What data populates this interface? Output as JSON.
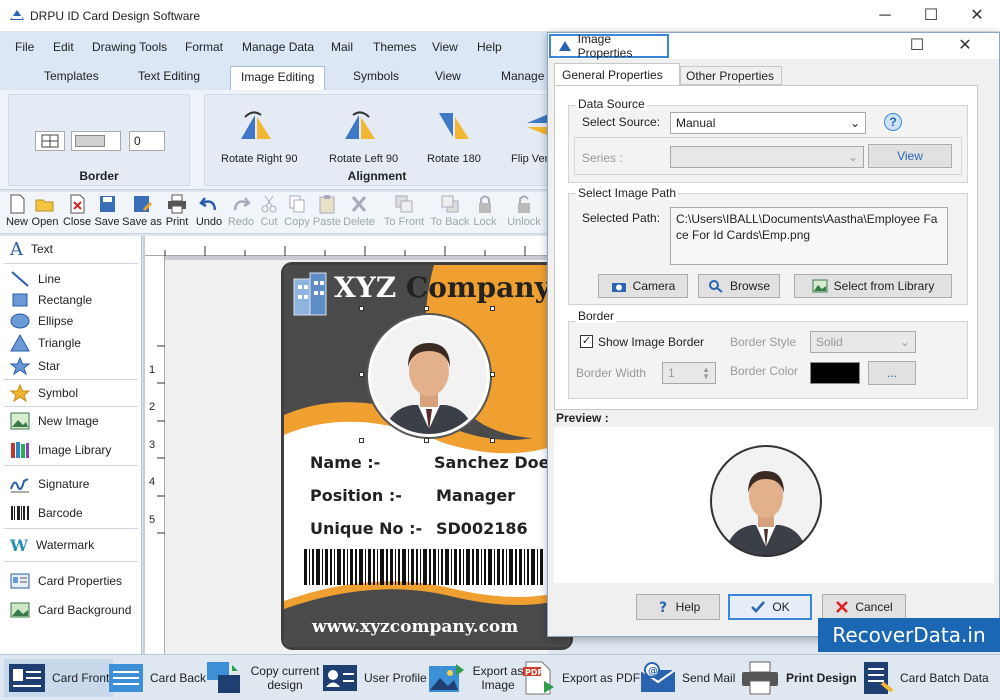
{
  "app": {
    "title": "DRPU ID Card Design Software"
  },
  "menu": [
    "File",
    "Edit",
    "Drawing Tools",
    "Format",
    "Manage Data",
    "Mail",
    "Themes",
    "View",
    "Help"
  ],
  "ribbon_tabs": [
    "Templates",
    "Text Editing",
    "Image Editing",
    "Symbols",
    "View",
    "Manage"
  ],
  "ribbon": {
    "border_label": "Border",
    "alignment_label": "Alignment",
    "border_value": "0",
    "rotate_right": "Rotate Right 90",
    "rotate_left": "Rotate Left 90",
    "rotate_180": "Rotate 180",
    "flip_vertical": "Flip Ver"
  },
  "toolbar": [
    "New",
    "Open",
    "Close",
    "Save",
    "Save as",
    "Print",
    "Undo",
    "Redo",
    "Cut",
    "Copy",
    "Paste",
    "Delete",
    "To Front",
    "To Back",
    "Lock",
    "Unlock"
  ],
  "tools": [
    "Text",
    "Line",
    "Rectangle",
    "Ellipse",
    "Triangle",
    "Star",
    "Symbol",
    "New Image",
    "Image Library",
    "Signature",
    "Barcode",
    "Watermark",
    "Card Properties",
    "Card Background"
  ],
  "ruler": [
    "1",
    "2",
    "3",
    "4",
    "5"
  ],
  "card": {
    "company": "XYZ Company",
    "name_label": "Name :-",
    "name_value": "Sanchez Doe",
    "position_label": "Position :-",
    "position_value": "Manager",
    "unique_label": "Unique No :-",
    "unique_value": "SD002186",
    "website": "www.xyzcompany.com"
  },
  "dialog": {
    "title": "Image Properties",
    "tab_general": "General Properties",
    "tab_other": "Other Properties",
    "data_source_title": "Data Source",
    "select_source_label": "Select Source:",
    "select_source_value": "Manual",
    "series_label": "Series :",
    "view_button": "View",
    "image_path_title": "Select Image Path",
    "selected_path_label": "Selected Path:",
    "selected_path_value": "C:\\Users\\IBALL\\Documents\\Aastha\\Employee Face For Id Cards\\Emp.png",
    "camera_button": "Camera",
    "browse_button": "Browse",
    "library_button": "Select from Library",
    "border_title": "Border",
    "show_border_label": "Show Image Border",
    "border_style_label": "Border Style",
    "border_style_value": "Solid",
    "border_width_label": "Border Width",
    "border_width_value": "1",
    "border_color_label": "Border Color",
    "border_color_value": "#000000",
    "color_button": "...",
    "preview_label": "Preview :",
    "help_button": "Help",
    "ok_button": "OK",
    "cancel_button": "Cancel"
  },
  "taskbar": [
    "Card Front",
    "Card Back",
    "Copy current design",
    "User Profile",
    "Export as Image",
    "Export as PDF",
    "Send Mail",
    "Print Design",
    "Card Batch Data"
  ],
  "watermark": "RecoverData.in",
  "colors": {
    "accent": "#f0a030",
    "dark": "#4a4a4a"
  }
}
